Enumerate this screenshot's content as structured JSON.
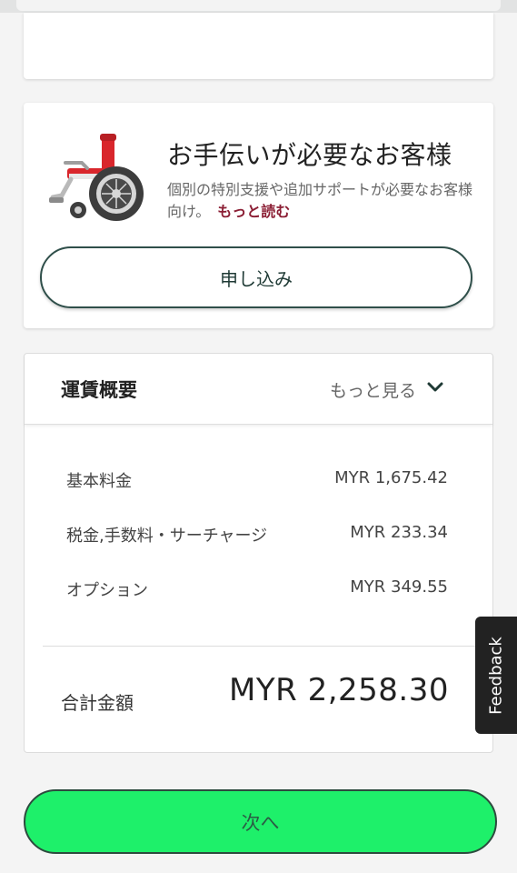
{
  "assistance": {
    "title": "お手伝いが必要なお客様",
    "description": "個別の特別支援や追加サポートが必要なお客様向け。",
    "read_more": "もっと読む",
    "apply_label": "申し込み",
    "icon": "wheelchair-icon"
  },
  "fare_summary": {
    "title": "運賃概要",
    "see_more": "もっと見る",
    "rows": [
      {
        "label": "基本料金",
        "value": "MYR 1,675.42"
      },
      {
        "label": "税金,手数料・サーチャージ",
        "value": "MYR 233.34"
      },
      {
        "label": "オプション",
        "value": "MYR 349.55"
      }
    ],
    "total_label": "合計金額",
    "total_value": "MYR 2,258.30"
  },
  "feedback_label": "Feedback",
  "next_label": "次へ",
  "colors": {
    "accent_green": "#1ef06a",
    "read_more": "#8b1e34",
    "dark_outline": "#2f4f4a"
  }
}
